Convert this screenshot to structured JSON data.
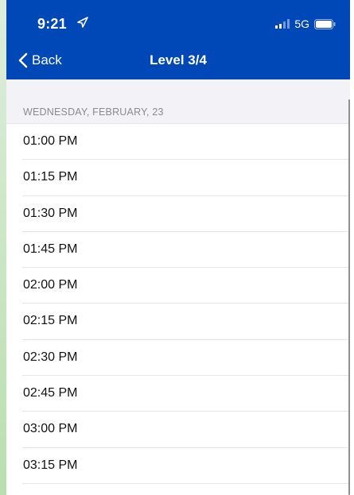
{
  "status": {
    "time": "9:21",
    "network": "5G"
  },
  "nav": {
    "back_label": "Back",
    "title": "Level 3/4"
  },
  "section": {
    "label": "WEDNESDAY, FEBRUARY, 23"
  },
  "times": [
    "01:00 PM",
    "01:15 PM",
    "01:30 PM",
    "01:45 PM",
    "02:00 PM",
    "02:15 PM",
    "02:30 PM",
    "02:45 PM",
    "03:00 PM",
    "03:15 PM"
  ],
  "colors": {
    "header": "#0047b8",
    "background": "#f2f2f7"
  },
  "icons": [
    "location-arrow-icon",
    "signal-icon",
    "battery-icon",
    "chevron-left-icon"
  ]
}
